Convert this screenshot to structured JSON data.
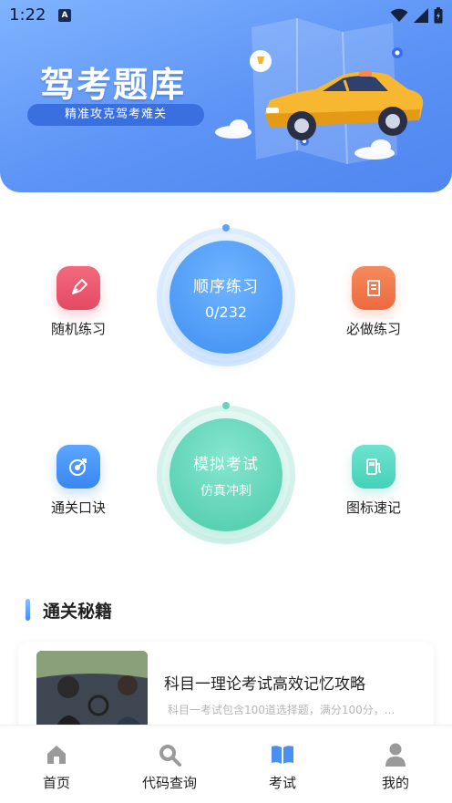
{
  "status_bar": {
    "time": "1:22",
    "badge": "A"
  },
  "banner": {
    "title": "驾考题库",
    "subtitle": "精准攻克驾考难关",
    "accent": "#5c93f5"
  },
  "practice": {
    "random": {
      "label": "随机练习",
      "icon": "pen-icon"
    },
    "sequential": {
      "title": "顺序练习",
      "progress": "0/232"
    },
    "must_do": {
      "label": "必做练习",
      "icon": "scroll-icon"
    },
    "tips": {
      "label": "通关口诀",
      "icon": "target-icon"
    },
    "mock_exam": {
      "title": "模拟考试",
      "subtitle": "仿真冲刺"
    },
    "signs": {
      "label": "图标速记",
      "icon": "fuel-icon"
    }
  },
  "section": {
    "title": "通关秘籍"
  },
  "articles": [
    {
      "title": "科目一理论考试高效记忆攻略",
      "summary": "科目一考试包含100道选择题，满分100分，..."
    }
  ],
  "tabs": [
    {
      "label": "首页",
      "icon": "home-icon",
      "active": false
    },
    {
      "label": "代码查询",
      "icon": "search-icon",
      "active": false
    },
    {
      "label": "考试",
      "icon": "book-icon",
      "active": true
    },
    {
      "label": "我的",
      "icon": "user-icon",
      "active": false
    }
  ]
}
